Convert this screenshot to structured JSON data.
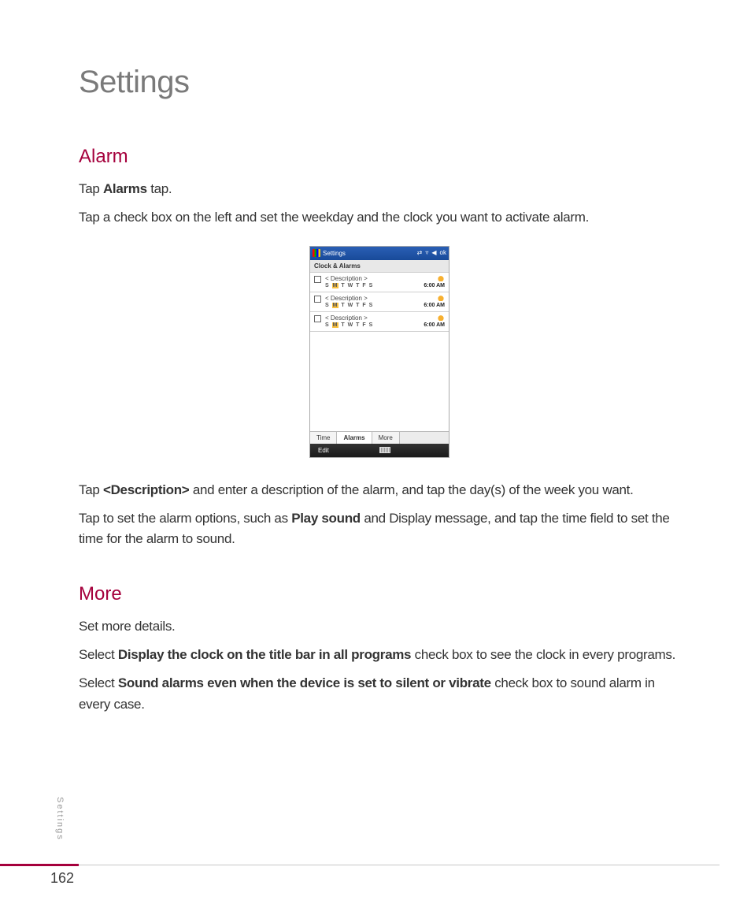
{
  "page": {
    "title": "Settings",
    "side_label": "Settings",
    "page_number": "162"
  },
  "alarm_section": {
    "heading": "Alarm",
    "p1_pre": "Tap ",
    "p1_bold": "Alarms",
    "p1_post": " tap.",
    "p2": "Tap a check box on the left and set the weekday and the clock you want to activate alarm.",
    "p3_pre": "Tap ",
    "p3_bold": "<Description>",
    "p3_post": " and enter a description of the alarm, and tap the day(s) of the week you want.",
    "p4_pre": "Tap to set the alarm options, such as ",
    "p4_bold": "Play sound",
    "p4_post": " and Display message, and tap the time field to set the time for the alarm to sound."
  },
  "more_section": {
    "heading": "More",
    "p1": "Set more details.",
    "p2_pre": "Select ",
    "p2_bold": "Display the clock on the title bar in all programs",
    "p2_post": " check box to see the clock  in every programs.",
    "p3_pre": "Select ",
    "p3_bold": "Sound alarms even when the device is set to silent or vibrate",
    "p3_post": " check box to sound alarm in every case."
  },
  "screenshot": {
    "status_title": "Settings",
    "status_ok": "ok",
    "subheader": "Clock & Alarms",
    "alarms": [
      {
        "desc": "< Description >",
        "days": "S M T W T F S",
        "time": "6:00 AM"
      },
      {
        "desc": "< Description >",
        "days": "S M T W T F S",
        "time": "6:00 AM"
      },
      {
        "desc": "< Description >",
        "days": "S M T W T F S",
        "time": "6:00 AM"
      }
    ],
    "tabs": {
      "time": "Time",
      "alarms": "Alarms",
      "more": "More"
    },
    "softkey_left": "Edit"
  }
}
